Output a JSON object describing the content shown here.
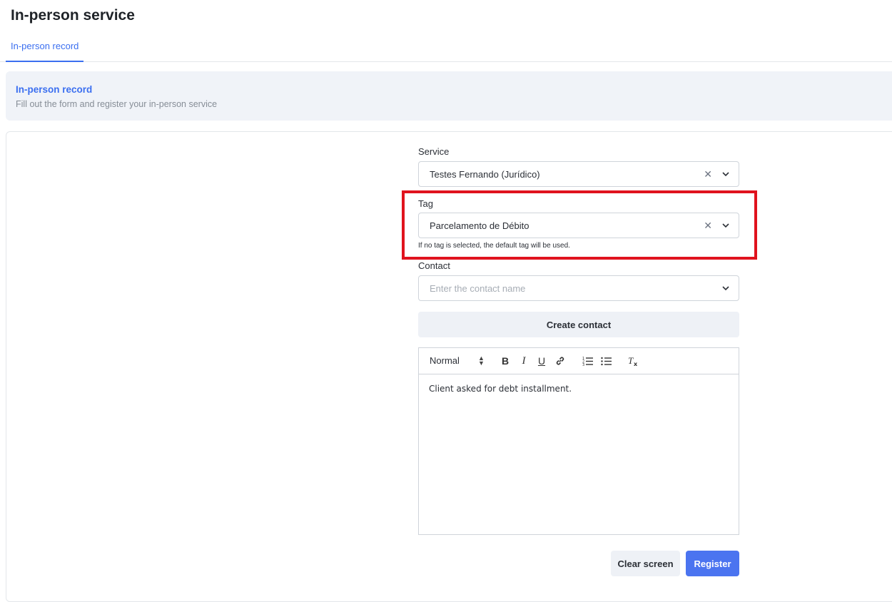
{
  "page": {
    "title": "In-person service"
  },
  "tabs": [
    {
      "label": "In-person record",
      "active": true
    }
  ],
  "banner": {
    "title": "In-person record",
    "subtitle": "Fill out the form and register your in-person service"
  },
  "form": {
    "service": {
      "label": "Service",
      "value": "Testes Fernando (Jurídico)"
    },
    "tag": {
      "label": "Tag",
      "value": "Parcelamento de Débito",
      "hint": "If no tag is selected, the default tag will be used."
    },
    "contact": {
      "label": "Contact",
      "placeholder": "Enter the contact name"
    },
    "create_contact_label": "Create contact",
    "editor": {
      "format_value": "Normal",
      "content": "Client asked for debt installment."
    }
  },
  "actions": {
    "clear_label": "Clear screen",
    "register_label": "Register"
  },
  "colors": {
    "accent": "#3b6ff0",
    "primary_button": "#4b74f0",
    "highlight": "#e0131e"
  },
  "icons": {
    "clear": "close-icon",
    "dropdown": "chevron-down-icon",
    "toolbar": [
      "bold-icon",
      "italic-icon",
      "underline-icon",
      "link-icon",
      "ordered-list-icon",
      "bullet-list-icon",
      "clear-format-icon"
    ]
  }
}
